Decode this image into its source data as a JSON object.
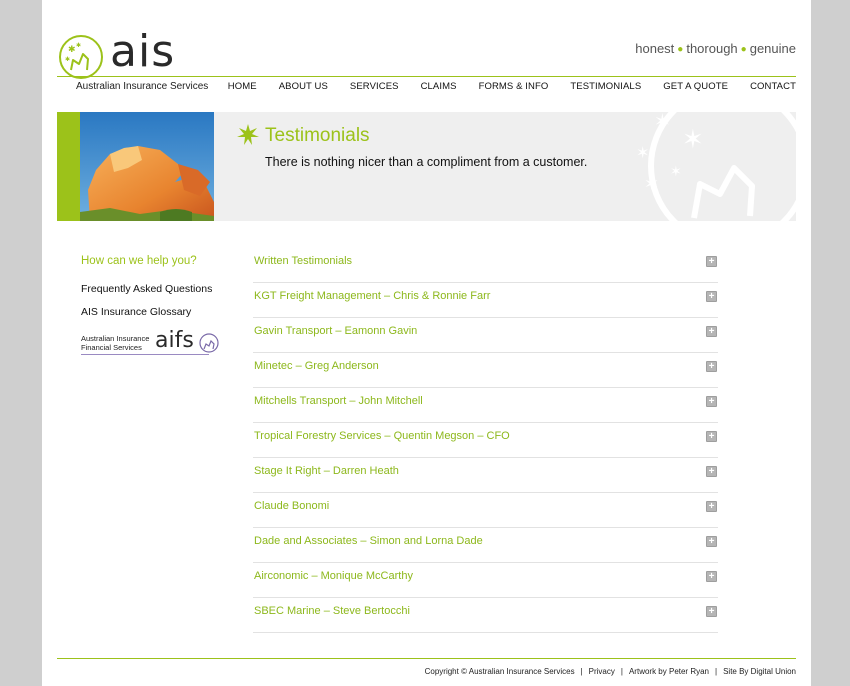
{
  "header": {
    "logo_word": "ais",
    "logo_subtitle": "Australian Insurance Services",
    "tagline": [
      "honest",
      "thorough",
      "genuine"
    ]
  },
  "nav": [
    "HOME",
    "ABOUT US",
    "SERVICES",
    "CLAIMS",
    "FORMS & INFO",
    "TESTIMONIALS",
    "GET A QUOTE",
    "CONTACT"
  ],
  "banner": {
    "title": "Testimonials",
    "subtitle": "There is nothing nicer than a compliment from a customer."
  },
  "sidebar": {
    "title": "How can we help you?",
    "links": [
      "Frequently Asked Questions",
      "AIS Insurance Glossary"
    ],
    "aifs_small": "Australian Insurance Financial Services",
    "aifs_word": "aifs"
  },
  "testimonials": [
    "Written Testimonials",
    "KGT Freight Management – Chris & Ronnie Farr",
    "Gavin Transport – Eamonn Gavin",
    "Minetec – Greg Anderson",
    "Mitchells Transport – John Mitchell",
    "Tropical Forestry Services – Quentin Megson – CFO",
    "Stage It Right – Darren Heath",
    "Claude Bonomi",
    "Dade and Associates – Simon and Lorna Dade",
    "Airconomic – Monique McCarthy",
    "SBEC Marine – Steve Bertocchi"
  ],
  "toggle_glyph": "+",
  "footer": {
    "copyright": "Copyright © Australian Insurance Services",
    "privacy": "Privacy",
    "artwork": "Artwork by Peter Ryan",
    "site_by": "Site By Digital Union"
  },
  "colors": {
    "accent": "#9cc21a",
    "background": "#cfcfcf",
    "banner": "#efefef"
  }
}
